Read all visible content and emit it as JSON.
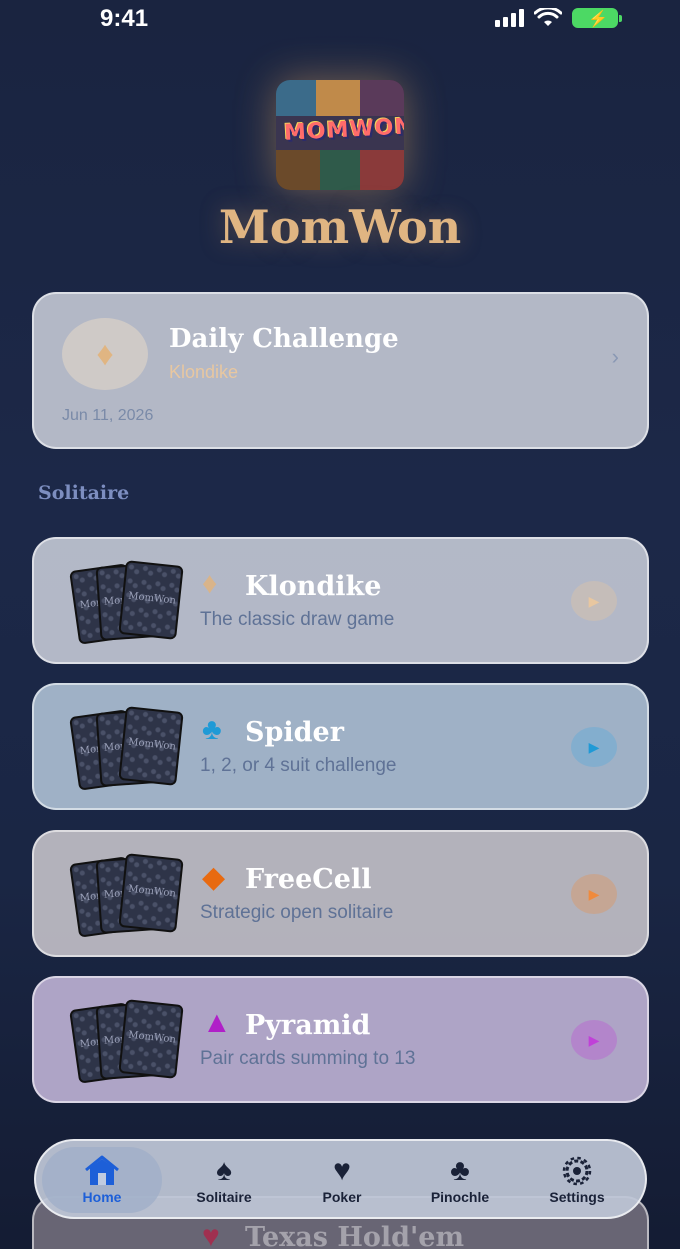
{
  "status": {
    "time": "9:41"
  },
  "app": {
    "title": "MomWon",
    "logo_text": "MOMWON!"
  },
  "daily": {
    "title": "Daily Challenge",
    "game": "Klondike",
    "date": "Jun 11, 2026",
    "icon": "diamond-icon"
  },
  "section": {
    "title": "Solitaire"
  },
  "games": [
    {
      "name": "Klondike",
      "desc": "The classic draw game",
      "suit": "♦",
      "suit_color": "#d9b48a",
      "play_color": "#e8c7a0"
    },
    {
      "name": "Spider",
      "desc": "1, 2, or 4 suit challenge",
      "suit": "♣",
      "suit_color": "#1f9ad6",
      "play_color": "#1f9ad6"
    },
    {
      "name": "FreeCell",
      "desc": "Strategic open solitaire",
      "suit": "◆",
      "suit_color": "#e86a10",
      "play_color": "#f08a3c"
    },
    {
      "name": "Pyramid",
      "desc": "Pair cards summing to 13",
      "suit": "▲",
      "suit_color": "#b020c8",
      "play_color": "#c040d8"
    },
    {
      "name": "Texas Hold'em",
      "suit": "♥",
      "suit_color": "#a03050"
    }
  ],
  "tabs": [
    {
      "label": "Home",
      "icon": "home-icon"
    },
    {
      "label": "Solitaire",
      "icon": "spade-icon"
    },
    {
      "label": "Poker",
      "icon": "heart-icon"
    },
    {
      "label": "Pinochle",
      "icon": "club-icon"
    },
    {
      "label": "Settings",
      "icon": "gear-icon"
    }
  ],
  "card_back_text": "MomWon"
}
